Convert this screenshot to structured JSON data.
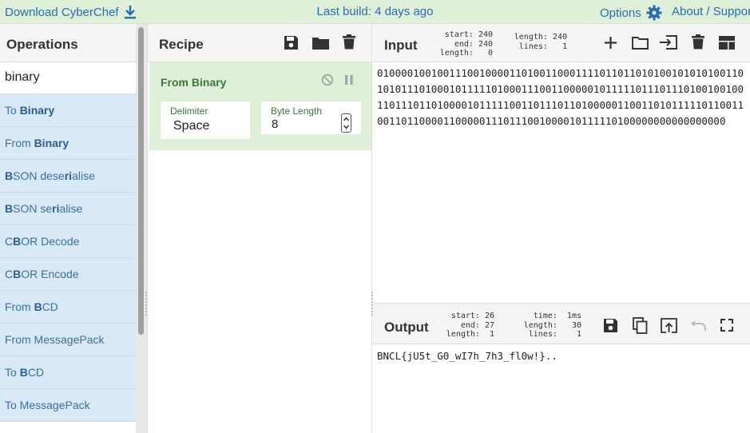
{
  "banner": {
    "download_label": "Download CyberChef",
    "last_build": "Last build: 4 days ago",
    "options_label": "Options",
    "about_label": "About / Support"
  },
  "operations": {
    "title": "Operations",
    "search_value": "binary",
    "items": [
      {
        "parts": [
          [
            "To ",
            false
          ],
          [
            "Binary",
            true
          ]
        ]
      },
      {
        "parts": [
          [
            "From ",
            false
          ],
          [
            "Binary",
            true
          ]
        ]
      },
      {
        "parts": [
          [
            "B",
            true
          ],
          [
            "SON dese",
            false
          ],
          [
            "r",
            true
          ],
          [
            "i",
            true
          ],
          [
            "alise",
            false
          ]
        ]
      },
      {
        "parts": [
          [
            "B",
            true
          ],
          [
            "SON se",
            false
          ],
          [
            "r",
            true
          ],
          [
            "i",
            true
          ],
          [
            "alise",
            false
          ]
        ]
      },
      {
        "parts": [
          [
            "C",
            false
          ],
          [
            "B",
            true
          ],
          [
            "OR Decode",
            false
          ]
        ]
      },
      {
        "parts": [
          [
            "C",
            false
          ],
          [
            "B",
            true
          ],
          [
            "OR Encode",
            false
          ]
        ]
      },
      {
        "parts": [
          [
            "From ",
            false
          ],
          [
            "B",
            true
          ],
          [
            "CD",
            false
          ]
        ]
      },
      {
        "parts": [
          [
            "From MessagePack",
            false
          ]
        ]
      },
      {
        "parts": [
          [
            "To ",
            false
          ],
          [
            "B",
            true
          ],
          [
            "CD",
            false
          ]
        ]
      },
      {
        "parts": [
          [
            "To MessagePack",
            false
          ]
        ]
      }
    ]
  },
  "recipe": {
    "title": "Recipe",
    "operation": {
      "name": "From Binary",
      "delimiter_label": "Delimiter",
      "delimiter_value": "Space",
      "byte_length_label": "Byte Length",
      "byte_length_value": "8"
    }
  },
  "input": {
    "title": "Input",
    "stats_left": "start: 240\n  end: 240\nlength:   0",
    "stats_right": "length: 240\n lines:   1",
    "text": "0100001001001110010000110100110001111011011010100101010100110101011101000101111101000111001100000101111101110111010010010011011101101000010111110011011101101000001100110101111101100110011011000011000001110111001000010111110100000000000000000"
  },
  "output": {
    "title": "Output",
    "stats_left": "start: 26\n  end: 27\nlength:  1",
    "stats_right": "  time:  1ms\nlength:   30\n lines:    1",
    "text": "BNCL{jU5t_G0_wI7h_7h3_fl0w!}.."
  },
  "colors": {
    "banner_bg": "#dff0d8",
    "link": "#2a6cb5",
    "op_item_bg": "#d9eaf6",
    "recipe_card_bg": "#dff0d8",
    "recipe_text": "#3c763d"
  }
}
